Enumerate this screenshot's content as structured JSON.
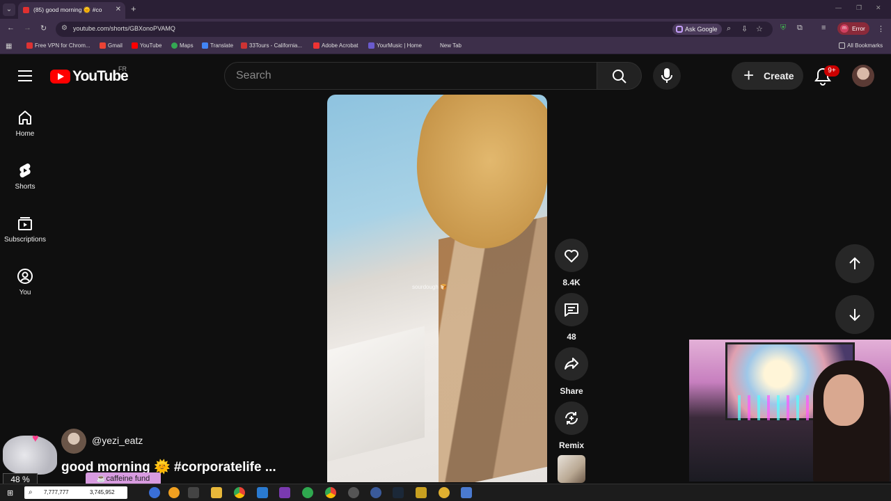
{
  "browser": {
    "tab_title": "(85) good morning 🌞 #co",
    "url": "youtube.com/shorts/GBXonoPVAMQ",
    "ask_google": "Ask Google",
    "profile_error": "Error",
    "profile_initial": "m",
    "bookmarks": [
      {
        "label": "Free VPN for Chrom...",
        "color": "#d33"
      },
      {
        "label": "Gmail",
        "color": "#ea4335"
      },
      {
        "label": "YouTube",
        "color": "#f00"
      },
      {
        "label": "Maps",
        "color": "#34a853"
      },
      {
        "label": "Translate",
        "color": "#4285f4"
      },
      {
        "label": "33Tours - California...",
        "color": "#c33"
      },
      {
        "label": "Adobe Acrobat",
        "color": "#e33"
      },
      {
        "label": "YourMusic | Home",
        "color": "#6a5acd"
      },
      {
        "label": "New Tab",
        "color": "#666"
      }
    ],
    "all_bookmarks": "All Bookmarks"
  },
  "youtube": {
    "logo_text": "YouTube",
    "country_code": "FR",
    "search_placeholder": "Search",
    "create_label": "Create",
    "notification_badge": "9+",
    "sidebar": [
      {
        "label": "Home",
        "icon": "home-icon"
      },
      {
        "label": "Shorts",
        "icon": "shorts-icon"
      },
      {
        "label": "Subscriptions",
        "icon": "subscriptions-icon"
      },
      {
        "label": "You",
        "icon": "you-icon"
      }
    ],
    "short": {
      "watermark": "sourdough 🍞",
      "channel_handle": "@yezi_eatz",
      "title": "good morning 🌞 #corporatelife ..."
    },
    "actions": {
      "like_count": "8.4K",
      "comment_count": "48",
      "share_label": "Share",
      "remix_label": "Remix"
    }
  },
  "overlays": {
    "percent": "48 %",
    "caffeine": "☕caffeine fund"
  },
  "taskbar": {
    "counter_a": "7,777,777",
    "counter_b": "3,745,952"
  },
  "colors": {
    "youtube_red": "#ff0000",
    "browser_frame": "#3d2f4a",
    "background": "#0f0f0f"
  }
}
